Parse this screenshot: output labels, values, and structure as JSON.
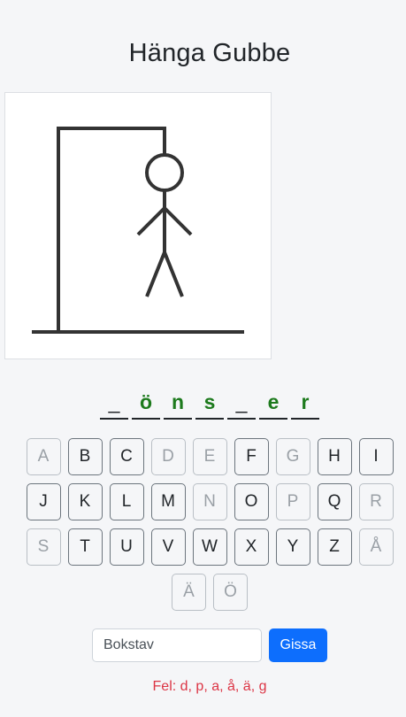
{
  "title": "Hänga Gubbe",
  "word": [
    {
      "char": "_",
      "revealed": false
    },
    {
      "char": "ö",
      "revealed": true
    },
    {
      "char": "n",
      "revealed": true
    },
    {
      "char": "s",
      "revealed": true
    },
    {
      "char": "_",
      "revealed": false
    },
    {
      "char": "e",
      "revealed": true
    },
    {
      "char": "r",
      "revealed": true
    }
  ],
  "keyboard": {
    "rows": [
      [
        {
          "letter": "A",
          "used": true
        },
        {
          "letter": "B",
          "used": false
        },
        {
          "letter": "C",
          "used": false
        },
        {
          "letter": "D",
          "used": true
        },
        {
          "letter": "E",
          "used": true
        },
        {
          "letter": "F",
          "used": false
        },
        {
          "letter": "G",
          "used": true
        },
        {
          "letter": "H",
          "used": false
        },
        {
          "letter": "I",
          "used": false
        }
      ],
      [
        {
          "letter": "J",
          "used": false
        },
        {
          "letter": "K",
          "used": false
        },
        {
          "letter": "L",
          "used": false
        },
        {
          "letter": "M",
          "used": false
        },
        {
          "letter": "N",
          "used": true
        },
        {
          "letter": "O",
          "used": false
        },
        {
          "letter": "P",
          "used": true
        },
        {
          "letter": "Q",
          "used": false
        },
        {
          "letter": "R",
          "used": true
        }
      ],
      [
        {
          "letter": "S",
          "used": true
        },
        {
          "letter": "T",
          "used": false
        },
        {
          "letter": "U",
          "used": false
        },
        {
          "letter": "V",
          "used": false
        },
        {
          "letter": "W",
          "used": false
        },
        {
          "letter": "X",
          "used": false
        },
        {
          "letter": "Y",
          "used": false
        },
        {
          "letter": "Z",
          "used": false
        },
        {
          "letter": "Å",
          "used": true
        }
      ],
      [
        {
          "letter": "Ä",
          "used": true
        },
        {
          "letter": "Ö",
          "used": true
        }
      ]
    ]
  },
  "guess": {
    "placeholder": "Bokstav",
    "value": "",
    "button_label": "Gissa"
  },
  "errors_text": "Fel: d, p, a, å, ä, g",
  "colors": {
    "background": "#f5f6f8",
    "correct_letter": "#1d7a1d",
    "error_text": "#dc3545",
    "primary_button": "#0d6efd",
    "gallows": "#333333"
  }
}
